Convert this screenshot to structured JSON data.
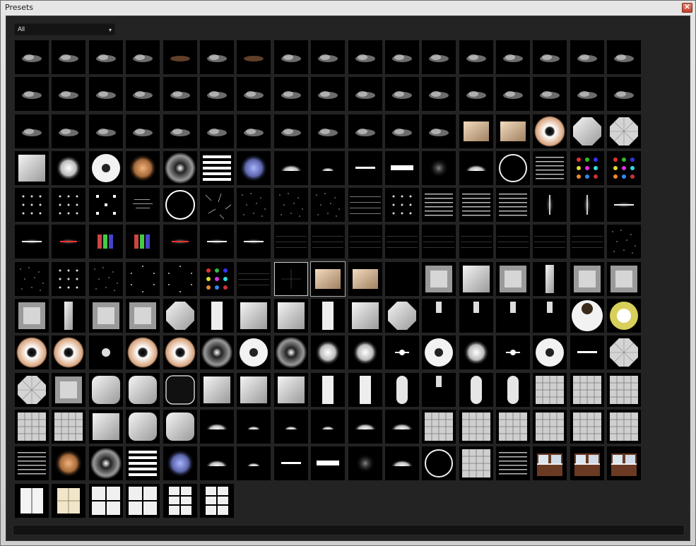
{
  "window": {
    "title": "Presets",
    "close_glyph": "✕"
  },
  "filter": {
    "value": "All",
    "caret": "▾"
  },
  "colors": {
    "panel": "#232323",
    "tile": "#000000",
    "titlebar": "#d9d9d9"
  },
  "presets": [
    "cloud",
    "cloud",
    "cloud",
    "cloud",
    "cloud_warm",
    "cloud",
    "cloud_warm",
    "cloud",
    "cloud",
    "cloud",
    "cloud",
    "cloud",
    "cloud",
    "cloud",
    "cloud",
    "cloud",
    "cloud",
    "cloud",
    "cloud",
    "cloud",
    "cloud",
    "cloud",
    "cloud",
    "cloud",
    "cloud",
    "cloud",
    "cloud",
    "cloud",
    "cloud",
    "cloud",
    "cloud",
    "cloud",
    "cloud",
    "cloud",
    "cloud",
    "cloud",
    "cloud",
    "cloud",
    "cloud",
    "cloud",
    "cloud",
    "cloud",
    "cloud",
    "cloud",
    "cloud",
    "cloud",
    "softbox_warm",
    "softbox_warm",
    "ring_warm",
    "octa_white",
    "umbrella",
    "softbox_white",
    "blob_white",
    "ring_white",
    "glow_orange",
    "ring_grey",
    "stripes",
    "glow_blue",
    "half_glow",
    "half_glow_small",
    "bar",
    "bar_thick",
    "dim_glow",
    "half_glow",
    "ring_thin",
    "stripes_fine",
    "dots_color",
    "dots_color",
    "dots_grid",
    "dots_grid",
    "dots_grid_big",
    "streaks",
    "ring_big",
    "scratches",
    "dots_scatter",
    "dots_scatter",
    "dots_scatter",
    "lines_fine",
    "dots_grid",
    "stripes_fine",
    "stripes_fine",
    "stripes_fine",
    "streak_vert",
    "streak_vert",
    "streak_h",
    "streak_h",
    "streak_red",
    "streak_color",
    "streak_color",
    "streak_red",
    "streak_h",
    "streak_h",
    "lines_dark",
    "lines_dark",
    "lines_dark",
    "lines_dark",
    "lines_dark",
    "lines_dark",
    "lines_dark",
    "lines_dark",
    "lines_dark",
    "dots_scatter",
    "dots_scatter",
    "dots_grid",
    "dots_scatter",
    "dots_circle",
    "dots_circle",
    "dots_color",
    "lines_dark",
    "crosshair",
    "softbox_warm",
    "softbox_warm",
    "empty",
    "softbox_grey",
    "softbox_white",
    "softbox_grey",
    "strip_grey",
    "softbox_grey",
    "softbox_grey",
    "softbox_grey",
    "strip_grey",
    "softbox_grey",
    "softbox_grey",
    "octa_white",
    "strip_white",
    "softbox_white",
    "softbox_white",
    "strip_white",
    "softbox_white",
    "octa_white",
    "strip_small",
    "strip_small",
    "strip_small",
    "strip_small",
    "ring_warm_dark",
    "ring_yellow",
    "ring_warm",
    "ring_warm",
    "blob_small",
    "ring_warm",
    "ring_warm",
    "ring_grey",
    "ring_white",
    "ring_grey",
    "blob_white",
    "blob_white",
    "bar_dot",
    "ring_white",
    "blob_white",
    "bar_dot",
    "ring_white",
    "bar",
    "umbrella",
    "umbrella",
    "softbox_grey",
    "rounded_white",
    "rounded_white",
    "rounded_dark",
    "softbox_white",
    "softbox_white",
    "softbox_white",
    "strip_white",
    "strip_white",
    "strip_rounded",
    "strip_small",
    "strip_rounded",
    "strip_rounded",
    "window_grid",
    "window_grid",
    "window_grid",
    "window_grid",
    "window_grid",
    "softbox_white",
    "rounded_white",
    "rounded_white",
    "half_glow",
    "half_glow_small",
    "half_glow_small",
    "half_glow_small",
    "half_glow",
    "half_glow",
    "window_grid",
    "window_grid",
    "window_grid",
    "window_grid",
    "window_grid",
    "window_grid",
    "stripes_fine",
    "glow_orange",
    "ring_grey",
    "stripes",
    "glow_blue",
    "half_glow",
    "half_glow_small",
    "bar",
    "bar_thick",
    "dim_glow",
    "half_glow",
    "ring_thin",
    "window_grid",
    "stripes_fine",
    "photo_window",
    "photo_window",
    "photo_window",
    "window_white",
    "window_cream",
    "window_quad",
    "window_quad",
    "window_six",
    "window_six"
  ],
  "selected_index": 110,
  "status": {
    "text": ""
  }
}
